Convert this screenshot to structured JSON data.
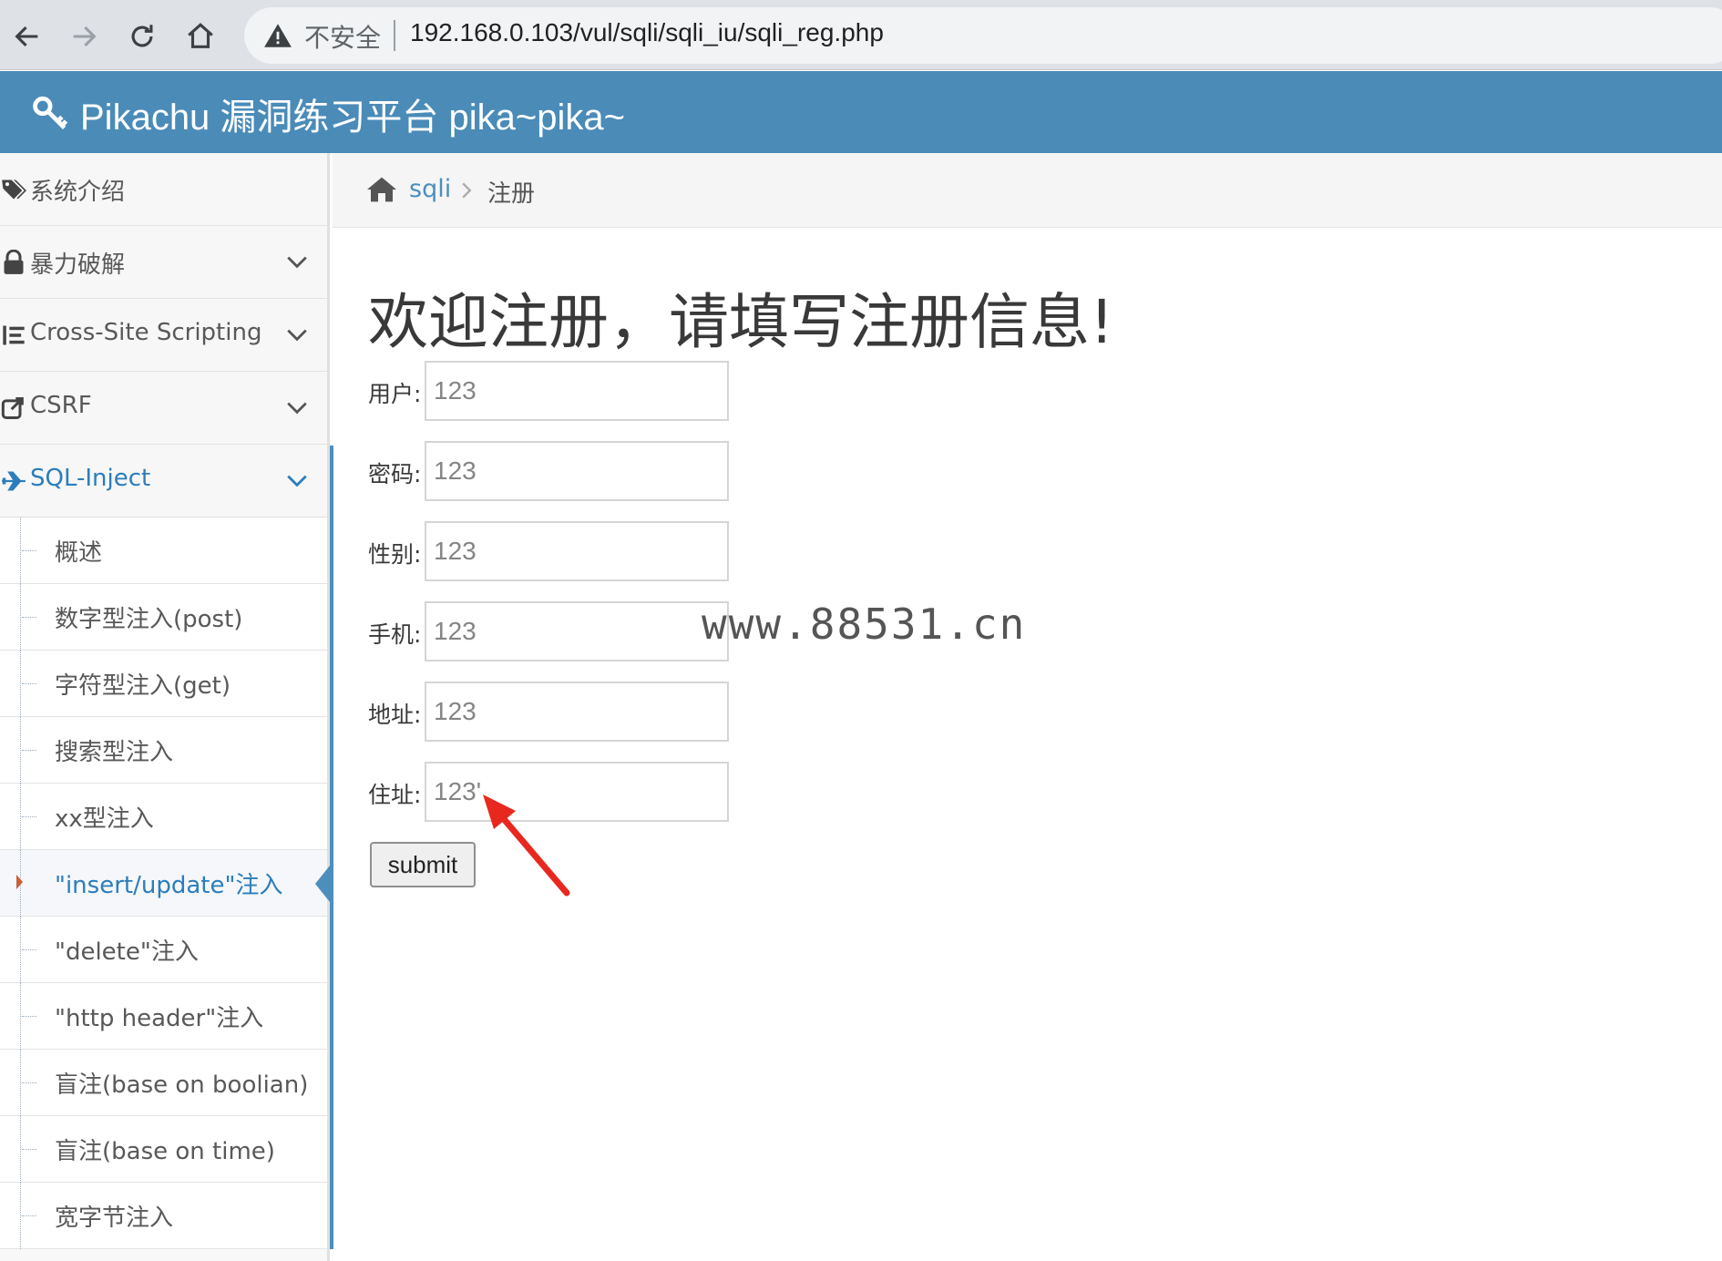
{
  "browser": {
    "security_label": "不安全",
    "url": "192.168.0.103/vul/sqli/sqli_iu/sqli_reg.php"
  },
  "header": {
    "brand": "Pikachu 漏洞练习平台 pika~pika~"
  },
  "sidebar": {
    "items": [
      {
        "label": "系统介绍",
        "icon": "tags-icon"
      },
      {
        "label": "暴力破解",
        "icon": "lock-icon"
      },
      {
        "label": "Cross-Site Scripting",
        "icon": "list-icon"
      },
      {
        "label": "CSRF",
        "icon": "share-icon"
      },
      {
        "label": "SQL-Inject",
        "icon": "plane-icon"
      }
    ],
    "submenu": [
      "概述",
      "数字型注入(post)",
      "字符型注入(get)",
      "搜索型注入",
      "xx型注入",
      "\"insert/update\"注入",
      "\"delete\"注入",
      "\"http header\"注入",
      "盲注(base on boolian)",
      "盲注(base on time)",
      "宽字节注入"
    ],
    "active_submenu": "\"insert/update\"注入"
  },
  "breadcrumb": {
    "link": "sqli",
    "current": "注册"
  },
  "main": {
    "title": "欢迎注册，请填写注册信息!",
    "fields": [
      {
        "label": "用户:",
        "value": "123"
      },
      {
        "label": "密码:",
        "value": "123"
      },
      {
        "label": "性别:",
        "value": "123"
      },
      {
        "label": "手机:",
        "value": "123"
      },
      {
        "label": "地址:",
        "value": "123"
      },
      {
        "label": "住址:",
        "value": "123'"
      }
    ],
    "submit_label": "submit"
  },
  "watermark": "www.88531.cn",
  "colors": {
    "header": "#4a8bb8",
    "accent": "#2b7dbc",
    "arrow": "#e8281f"
  }
}
